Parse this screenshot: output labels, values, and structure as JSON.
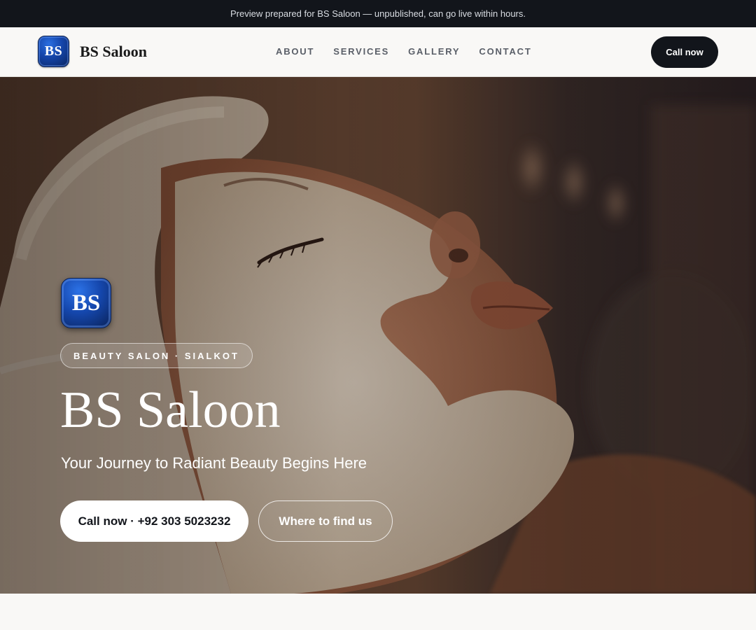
{
  "topbar": {
    "notice": "Preview prepared for BS Saloon — unpublished, can go live within hours."
  },
  "nav": {
    "logo_text": "BS",
    "brand_name": "BS Saloon",
    "links": [
      "ABOUT",
      "SERVICES",
      "GALLERY",
      "CONTACT"
    ],
    "cta_label": "Call now"
  },
  "hero": {
    "logo_text": "BS",
    "tagline": "BEAUTY SALON · SIALKOT",
    "title": "BS Saloon",
    "subtitle": "Your Journey to Radiant Beauty Begins Here",
    "primary_button": "Call now · +92 303 5023232",
    "secondary_button": "Where to find us",
    "background_image": "woman-facial-mask-photo"
  },
  "colors": {
    "dark": "#12151b",
    "logo_blue": "#1444a8",
    "page_bg": "#f9f8f6"
  }
}
